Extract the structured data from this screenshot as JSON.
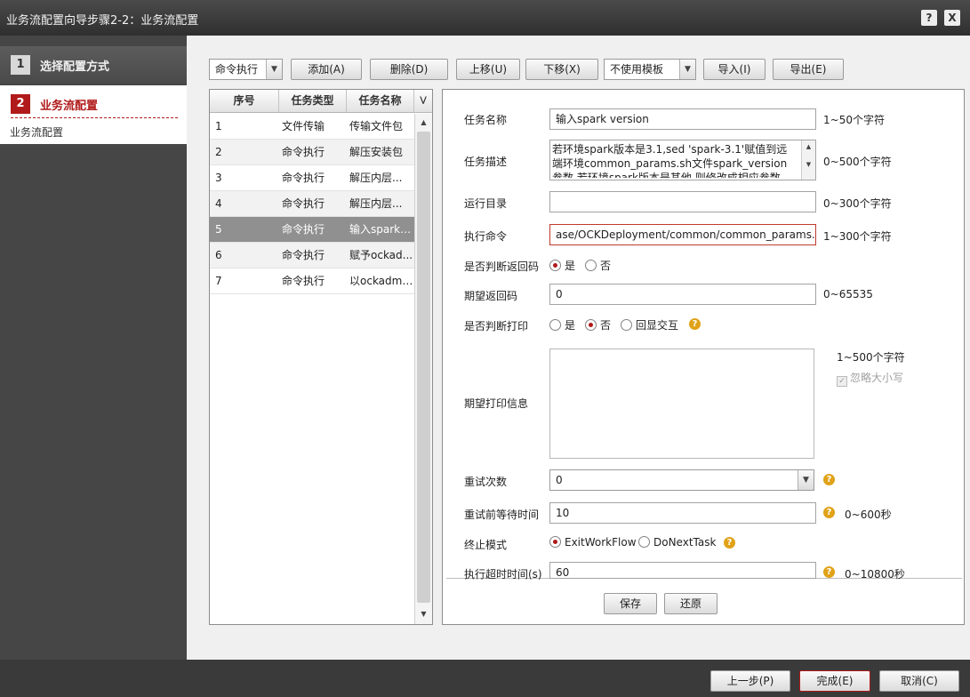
{
  "window": {
    "title": "业务流配置向导步骤2-2：业务流配置",
    "help_label": "?",
    "close_label": "X"
  },
  "steps": [
    {
      "num": "1",
      "title": "选择配置方式"
    },
    {
      "num": "2",
      "title": "业务流配置",
      "sub": "业务流配置"
    }
  ],
  "toolbar": {
    "type_select": "命令执行",
    "add": "添加(A)",
    "delete": "删除(D)",
    "up": "上移(U)",
    "down": "下移(X)",
    "template_select": "不使用模板",
    "import": "导入(I)",
    "export": "导出(E)"
  },
  "table": {
    "headers": [
      "序号",
      "任务类型",
      "任务名称"
    ],
    "rows": [
      {
        "id": "1",
        "type": "文件传输",
        "name": "传输文件包"
      },
      {
        "id": "2",
        "type": "命令执行",
        "name": "解压安装包"
      },
      {
        "id": "3",
        "type": "命令执行",
        "name": "解压内层..."
      },
      {
        "id": "4",
        "type": "命令执行",
        "name": "解压内层..."
      },
      {
        "id": "5",
        "type": "命令执行",
        "name": "输入spark ..."
      },
      {
        "id": "6",
        "type": "命令执行",
        "name": "赋予ockad..."
      },
      {
        "id": "7",
        "type": "命令执行",
        "name": "以ockadmi..."
      }
    ]
  },
  "form": {
    "task_name": {
      "label": "任务名称",
      "value": "输入spark version",
      "hint": "1~50个字符"
    },
    "task_desc": {
      "label": "任务描述",
      "value": "若环境spark版本是3.1,sed 'spark-3.1'赋值到远端环境common_params.sh文件spark_version参数,若环境spark版本是其他,则修改成相应参数",
      "hint": "0~500个字符"
    },
    "run_dir": {
      "label": "运行目录",
      "value": "",
      "hint": "0~300个字符"
    },
    "exec_cmd": {
      "label": "执行命令",
      "value": "ase/OCKDeployment/common/common_params.sh",
      "hint": "1~300个字符"
    },
    "check_return": {
      "label": "是否判断返回码",
      "yes": "是",
      "no": "否"
    },
    "expected_return": {
      "label": "期望返回码",
      "value": "0",
      "hint": "0~65535"
    },
    "check_print": {
      "label": "是否判断打印",
      "yes": "是",
      "no": "否",
      "interactive": "回显交互"
    },
    "expected_print": {
      "label": "期望打印信息",
      "value": "",
      "hint": "1~500个字符",
      "ignore_case": "忽略大小写"
    },
    "retry_count": {
      "label": "重试次数",
      "value": "0"
    },
    "retry_wait": {
      "label": "重试前等待时间",
      "value": "10",
      "hint": "0~600秒"
    },
    "stop_mode": {
      "label": "终止模式",
      "opt1": "ExitWorkFlow",
      "opt2": "DoNextTask"
    },
    "timeout": {
      "label": "执行超时时间(s)",
      "value": "60",
      "hint": "0~10800秒"
    },
    "save": "保存",
    "restore": "还原"
  },
  "footer": {
    "prev": "上一步(P)",
    "finish": "完成(E)",
    "cancel": "取消(C)"
  }
}
